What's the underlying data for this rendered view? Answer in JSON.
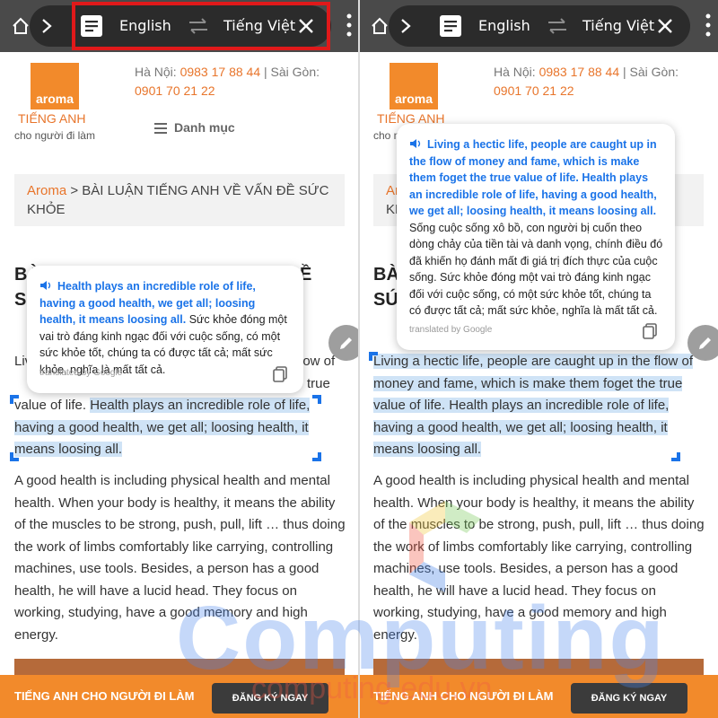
{
  "toolbar": {
    "source_language": "English",
    "target_language": "Tiếng Việt"
  },
  "site": {
    "logo_word": "aroma",
    "logo_line1": "TIẾNG ANH",
    "logo_line2": "cho người đi làm",
    "contact_hanoi_label": "Hà Nội:",
    "contact_hanoi_phone": "0983 17 88 44",
    "contact_separator": "|",
    "contact_saigon_label": "Sài Gòn:",
    "contact_saigon_phone": "0901 70 21 22",
    "menu_label": "Danh mục"
  },
  "breadcrumb": {
    "home": "Aroma",
    "separator": ">",
    "current": "BÀI LUẬN TIẾNG ANH VỀ VẤN ĐỀ SỨC KHỎE"
  },
  "left": {
    "heading_line1": "BÀ",
    "heading_line1_tail": "Ề",
    "heading_line2": "S",
    "para1_start": "Liv",
    "para1_tail_1": "low of",
    "para1_tail_2": "true",
    "para1_plain": "value of life.",
    "para1_selected": "Health plays an incredible role of life, having a good health, we get all; loosing health, it means loosing all.",
    "popup_source": "Health plays an incredible role of life, having a good health, we get all; loosing health, it means loosing all.",
    "popup_translation": "Sức khỏe đóng một vai trò đáng kinh ngạc đối với cuộc sống, có một sức khỏe tốt, chúng ta có được tất cả; mất sức khỏe, nghĩa là mất tất cả."
  },
  "right": {
    "heading_line1": "BÀ",
    "heading_line2": "SÚ",
    "breadcrumb_visible_1": "Ar",
    "breadcrumb_visible_2": "KH",
    "para1_selected": "Living a hectic life, people are caught up in the flow of money and fame, which is make them foget the true value of life. Health plays an incredible role of life, having a good health, we get all; loosing health, it means loosing all.",
    "popup_source": "Living a hectic life, people are caught up in the flow of money and fame, which is make them foget the true value of life. Health plays an incredible role of life, having a good health, we get all; loosing health, it means loosing all.",
    "popup_translation": "Sống cuộc sống xô bồ, con người bị cuốn theo dòng chảy của tiền tài và danh vọng, chính điều đó đã khiến họ đánh mất đi giá trị đích thực của cuộc sống. Sức khỏe đóng một vai trò đáng kinh ngạc đối với cuộc sống, có một sức khỏe tốt, chúng ta có được tất cả; mất sức khỏe, nghĩa là mất tất cả."
  },
  "popup_credit": "translated by Google",
  "paragraph2": "A good health is including physical health and mental health. When your body is healthy, it means the ability of the muscles to be strong, push, pull, lift … thus doing the work of limbs comfortably like carrying, controlling machines, use tools. Besides, a person has a good health, he will have a lucid head. They focus on working, studying, have a good memory and high energy.",
  "banner": {
    "text": "TIẾNG ANH CHO NGƯỜI ĐI LÀM",
    "button": "ĐĂNG KÝ NGAY"
  },
  "watermark": {
    "main": "Computing",
    "sub": "computing.edu.vn"
  },
  "colors": {
    "accent_orange": "#f28a2b",
    "link_blue": "#1a73e8",
    "selection": "#cfe3f6",
    "highlight_red": "#e0191a"
  }
}
